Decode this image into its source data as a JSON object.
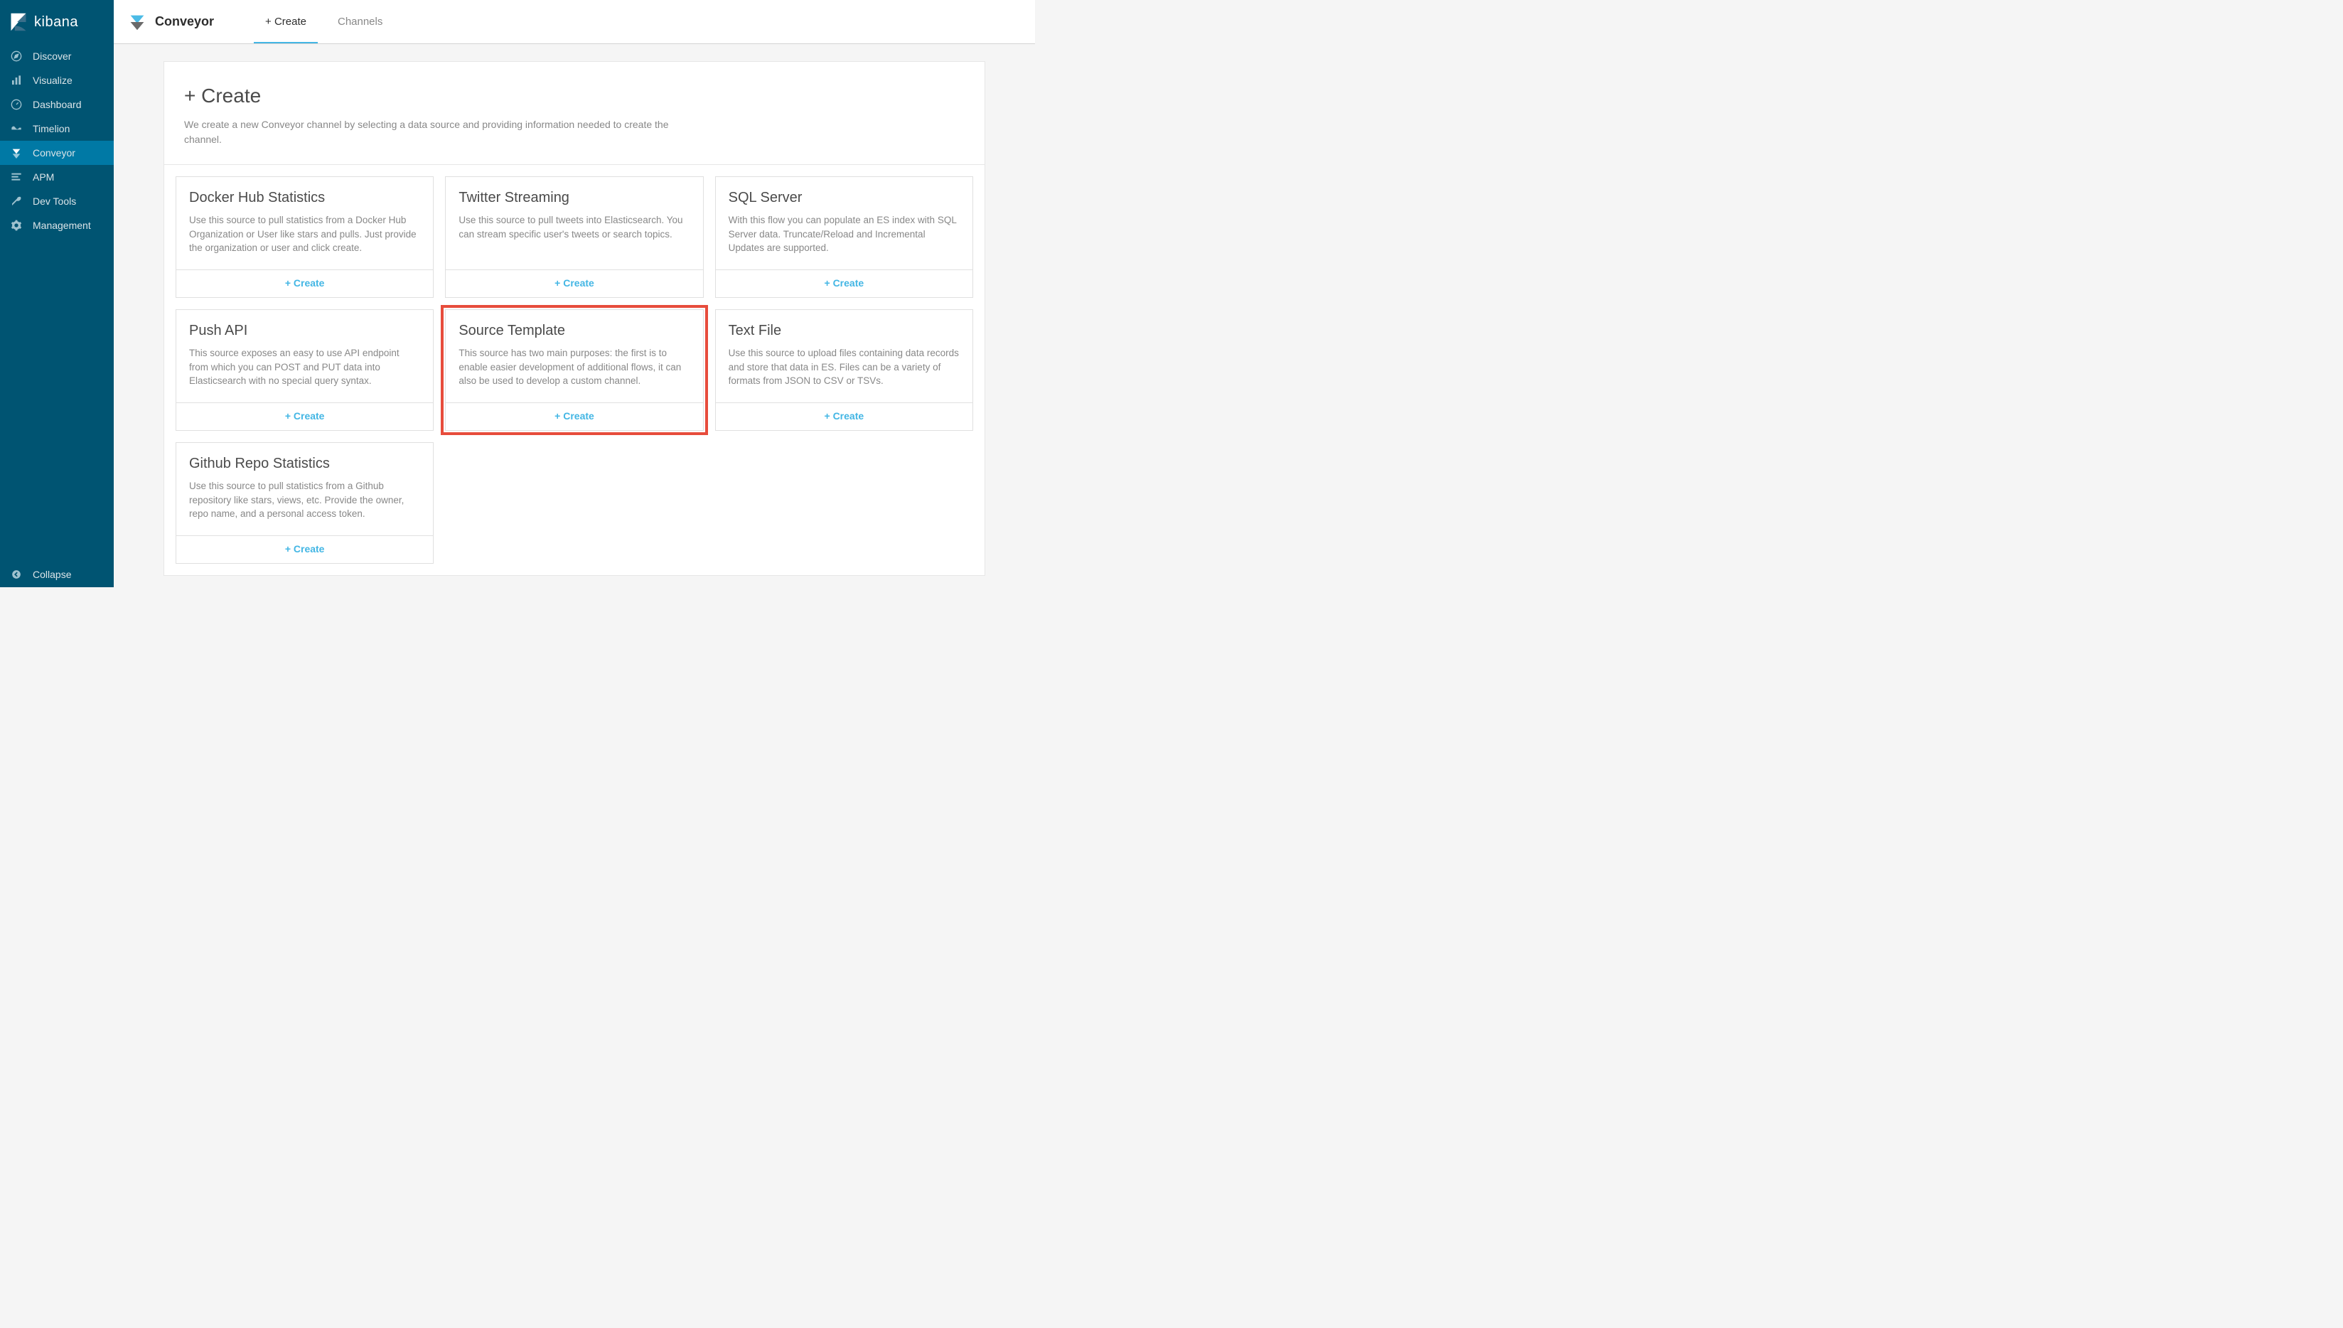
{
  "brand": {
    "name": "kibana"
  },
  "sidebar": {
    "items": [
      {
        "label": "Discover",
        "icon": "compass"
      },
      {
        "label": "Visualize",
        "icon": "bar-chart"
      },
      {
        "label": "Dashboard",
        "icon": "gauge"
      },
      {
        "label": "Timelion",
        "icon": "timeline"
      },
      {
        "label": "Conveyor",
        "icon": "conveyor"
      },
      {
        "label": "APM",
        "icon": "stack"
      },
      {
        "label": "Dev Tools",
        "icon": "wrench"
      },
      {
        "label": "Management",
        "icon": "gear"
      }
    ],
    "collapse_label": "Collapse"
  },
  "app": {
    "title": "Conveyor",
    "tabs": [
      {
        "label": "+ Create",
        "active": true
      },
      {
        "label": "Channels",
        "active": false
      }
    ]
  },
  "page": {
    "title": "+ Create",
    "description": "We create a new Conveyor channel by selecting a data source and providing information needed to create the channel."
  },
  "cards": [
    {
      "title": "Docker Hub Statistics",
      "description": "Use this source to pull statistics from a Docker Hub Organization or User like stars and pulls. Just provide the organization or user and click create.",
      "action_label": "+ Create",
      "highlighted": false
    },
    {
      "title": "Twitter Streaming",
      "description": "Use this source to pull tweets into Elasticsearch. You can stream specific user's tweets or search topics.",
      "action_label": "+ Create",
      "highlighted": false
    },
    {
      "title": "SQL Server",
      "description": "With this flow you can populate an ES index with SQL Server data. Truncate/Reload and Incremental Updates are supported.",
      "action_label": "+ Create",
      "highlighted": false
    },
    {
      "title": "Push API",
      "description": "This source exposes an easy to use API endpoint from which you can POST and PUT data into Elasticsearch with no special query syntax.",
      "action_label": "+ Create",
      "highlighted": false
    },
    {
      "title": "Source Template",
      "description": "This source has two main purposes: the first is to enable easier development of additional flows, it can also be used to develop a custom channel.",
      "action_label": "+ Create",
      "highlighted": true
    },
    {
      "title": "Text File",
      "description": "Use this source to upload files containing data records and store that data in ES. Files can be a variety of formats from JSON to CSV or TSVs.",
      "action_label": "+ Create",
      "highlighted": false
    },
    {
      "title": "Github Repo Statistics",
      "description": "Use this source to pull statistics from a Github repository like stars, views, etc. Provide the owner, repo name, and a personal access token.",
      "action_label": "+ Create",
      "highlighted": false
    }
  ]
}
